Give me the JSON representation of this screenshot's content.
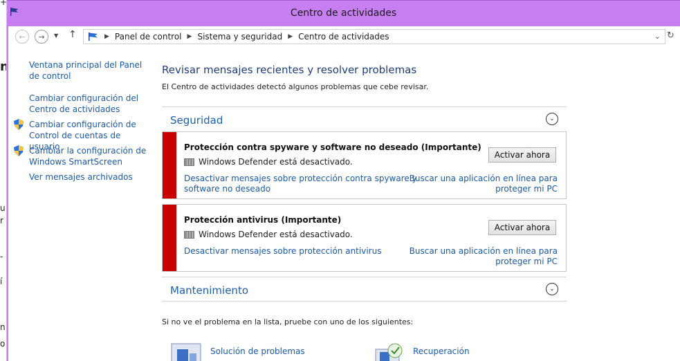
{
  "window": {
    "title": "Centro de actividades"
  },
  "left_strip": {
    "chars": [
      "+",
      "n",
      "u",
      "r",
      "-",
      "í",
      "n",
      "o"
    ]
  },
  "navbar": {
    "back_icon": "back-arrow-icon",
    "forward_icon": "forward-arrow-icon",
    "recent_icon": "chevron-down-icon",
    "up_icon": "up-arrow-icon",
    "breadcrumbs": [
      "Panel de control",
      "Sistema y seguridad",
      "Centro de actividades"
    ],
    "refresh_icon": "refresh-icon"
  },
  "sidebar": {
    "items": [
      {
        "label": "Ventana principal del Panel de control",
        "icon": ""
      },
      {
        "label": "Cambiar configuración del Centro de actividades",
        "icon": ""
      },
      {
        "label": "Cambiar configuración de Control de cuentas de usuario",
        "icon": "shield-icon"
      },
      {
        "label": "Cambiar la configuración de Windows SmartScreen",
        "icon": "shield-icon"
      },
      {
        "label": "Ver mensajes archivados",
        "icon": ""
      }
    ]
  },
  "main": {
    "heading": "Revisar mensajes recientes y resolver problemas",
    "intro": "El Centro de actividades detectó algunos problemas que cebe revisar.",
    "security": {
      "label": "Seguridad",
      "alerts": [
        {
          "title": "Protección contra spyware y software no deseado (Importante)",
          "status": "Windows Defender está desactivado.",
          "button": "Activar ahora",
          "left_link_line1": "Desactivar mensajes sobre protección contra spyware y",
          "left_link_line2": "software no deseado",
          "right_link_line1": "Buscar una aplicación en línea para",
          "right_link_line2": "proteger mi PC"
        },
        {
          "title": "Protección antivirus (Importante)",
          "status": "Windows Defender está desactivado.",
          "button": "Activar ahora",
          "left_link_line1": "Desactivar mensajes sobre protección antivirus",
          "right_link_line1": "Buscar una aplicación en línea para",
          "right_link_line2": "proteger mi PC"
        }
      ]
    },
    "maintenance": {
      "label": "Mantenimiento"
    },
    "try_line": "Si no ve el problema en la lista, pruebe con uno de los siguientes:",
    "tools": [
      {
        "label": "Solución de problemas",
        "icon": "troubleshooting-icon"
      },
      {
        "label": "Recuperación",
        "icon": "recovery-icon"
      }
    ]
  },
  "colors": {
    "titlebar": "#c67ef0",
    "alert_bar": "#c80000",
    "link": "#1c5aa6",
    "heading": "#1e3d7b"
  }
}
